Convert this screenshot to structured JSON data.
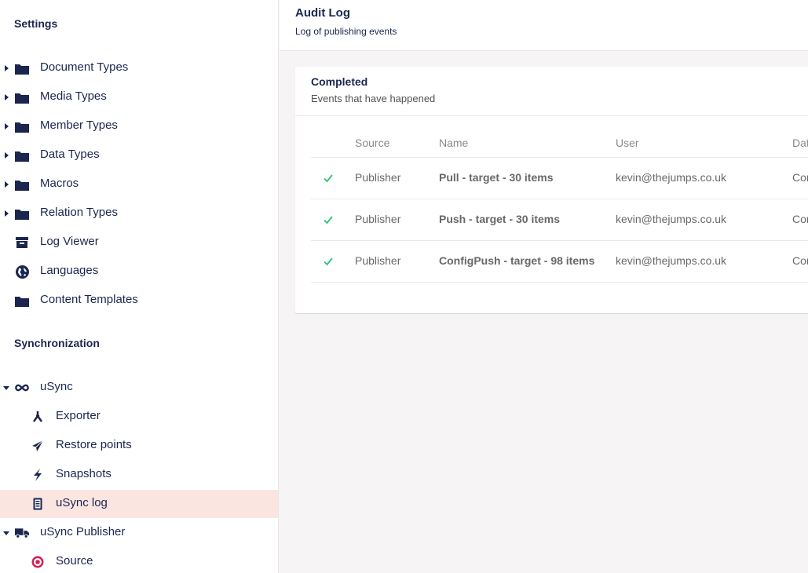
{
  "sidebar": {
    "settings_title": "Settings",
    "settings_items": [
      {
        "label": "Document Types",
        "icon": "folder-icon",
        "expandable": true
      },
      {
        "label": "Media Types",
        "icon": "folder-icon",
        "expandable": true
      },
      {
        "label": "Member Types",
        "icon": "folder-icon",
        "expandable": true
      },
      {
        "label": "Data Types",
        "icon": "folder-icon",
        "expandable": true
      },
      {
        "label": "Macros",
        "icon": "folder-icon",
        "expandable": true
      },
      {
        "label": "Relation Types",
        "icon": "folder-icon",
        "expandable": true
      },
      {
        "label": "Log Viewer",
        "icon": "archive-box-icon",
        "expandable": false
      },
      {
        "label": "Languages",
        "icon": "globe-icon",
        "expandable": false
      },
      {
        "label": "Content Templates",
        "icon": "folder-icon",
        "expandable": false
      }
    ],
    "sync_title": "Synchronization",
    "usync": {
      "label": "uSync",
      "icon": "infinity-icon"
    },
    "usync_children": [
      {
        "label": "Exporter",
        "icon": "branch-icon"
      },
      {
        "label": "Restore points",
        "icon": "paper-plane-icon"
      },
      {
        "label": "Snapshots",
        "icon": "lightning-icon"
      },
      {
        "label": "uSync log",
        "icon": "log-document-icon",
        "selected": true
      }
    ],
    "publisher": {
      "label": "uSync Publisher",
      "icon": "truck-icon"
    },
    "publisher_children": [
      {
        "label": "Source",
        "icon": "target-icon"
      }
    ]
  },
  "header": {
    "title": "Audit Log",
    "subtitle": "Log of publishing events"
  },
  "panel": {
    "title": "Completed",
    "subtitle": "Events that have happened",
    "columns": [
      "Source",
      "Name",
      "User",
      "Dat"
    ],
    "rows": [
      {
        "status": "check-icon",
        "source": "Publisher",
        "name": "Pull - target - 30 items",
        "user": "kevin@thejumps.co.uk",
        "date": "Cor"
      },
      {
        "status": "check-icon",
        "source": "Publisher",
        "name": "Push - target - 30 items",
        "user": "kevin@thejumps.co.uk",
        "date": "Cor"
      },
      {
        "status": "check-icon",
        "source": "Publisher",
        "name": "ConfigPush - target - 98 items",
        "user": "kevin@thejumps.co.uk",
        "date": "Cor"
      }
    ]
  },
  "colors": {
    "navy": "#1b264f",
    "selected_bg": "#fbe5e1",
    "check_green": "#2bc37c",
    "target_red": "#d42054"
  }
}
